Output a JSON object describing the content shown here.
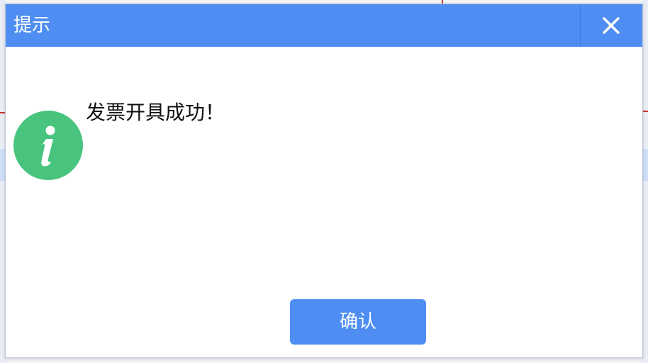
{
  "dialog": {
    "title": "提示",
    "close_icon": "close-icon",
    "message": "发票开具成功！",
    "status_icon": "info-icon",
    "confirm_label": "确认"
  },
  "colors": {
    "title_bar": "#4e8ef2",
    "info_icon": "#48c47e",
    "confirm_button": "#4e8ef2"
  }
}
